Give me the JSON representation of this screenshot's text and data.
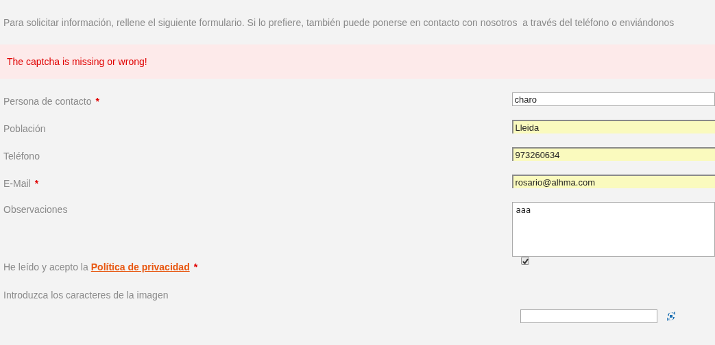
{
  "intro": "Para solicitar información, rellene el siguiente formulario. Si lo prefiere, también puede ponerse en contacto con nosotros  a través del teléfono o enviándonos",
  "error": "The captcha is missing or wrong!",
  "fields": [
    {
      "kind": "text",
      "label": "Persona de contacto",
      "required_mark": "*",
      "value": "charo",
      "autofilled": false
    },
    {
      "kind": "text",
      "label": "Población",
      "value": "Lleida",
      "autofilled": true
    },
    {
      "kind": "text",
      "label": "Teléfono",
      "value": "973260634",
      "autofilled": true
    },
    {
      "kind": "text",
      "label": "E-Mail",
      "required_mark": "*",
      "value": "rosario@alhma.com",
      "autofilled": true
    },
    {
      "kind": "textarea",
      "label": "Observaciones",
      "value": "aaa"
    },
    {
      "kind": "checkbox",
      "label": "He leído y acepto la",
      "link": "Política de privacidad",
      "required_mark": "*",
      "checked": true
    },
    {
      "kind": "captcha",
      "label": "Introduzca los caracteres de la imagen"
    }
  ]
}
